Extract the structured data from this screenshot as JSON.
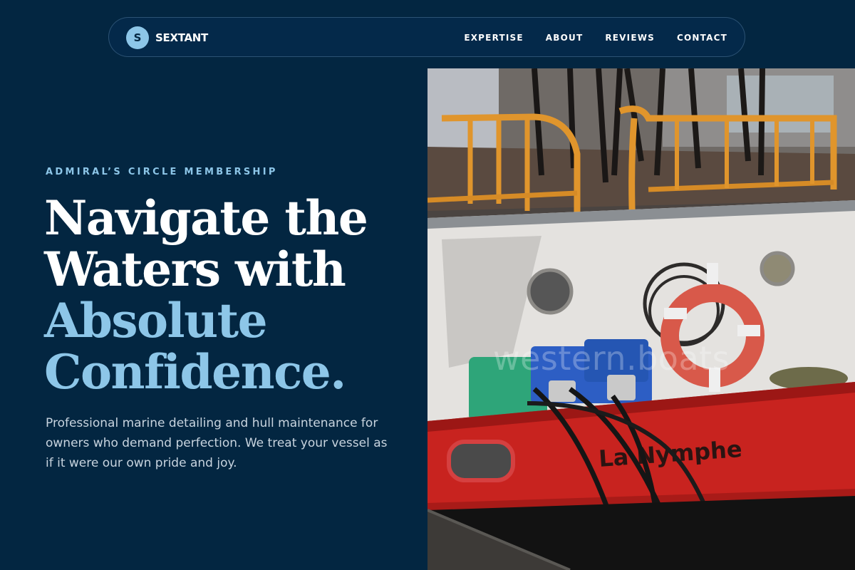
{
  "brand": {
    "logo_letter": "S",
    "name": "SEXTANT"
  },
  "nav": {
    "items": [
      "EXPERTISE",
      "ABOUT",
      "REVIEWS",
      "CONTACT"
    ]
  },
  "hero": {
    "eyebrow": "ADMIRAL’S CIRCLE MEMBERSHIP",
    "headline_line1": "Navigate the",
    "headline_line2": "Waters with",
    "headline_line3": "Absolute",
    "headline_line4": "Confidence.",
    "body": "Professional marine detailing and hull maintenance for owners who demand perfection. We treat your vessel as if it were our own pride and joy."
  },
  "image": {
    "boat_name": "La Nymphe",
    "watermark": "western.boats"
  },
  "colors": {
    "background": "#032641",
    "accent": "#8dc6e8",
    "hull_red": "#c8231f",
    "railing_orange": "#e0952c"
  }
}
